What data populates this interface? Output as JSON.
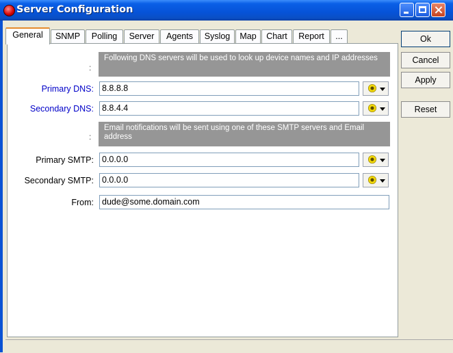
{
  "window": {
    "title": "Server Configuration"
  },
  "tabs": [
    "General",
    "SNMP",
    "Polling",
    "Server",
    "Agents",
    "Syslog",
    "Map",
    "Chart",
    "Report",
    "..."
  ],
  "active_tab": "General",
  "dns": {
    "info": "Following DNS servers will be used to look up device names and IP addresses",
    "colon": ":",
    "primary_label": "Primary DNS:",
    "primary_value": "8.8.8.8",
    "secondary_label": "Secondary DNS:",
    "secondary_value": "8.8.4.4"
  },
  "smtp": {
    "info": "Email notifications will be sent using one of these SMTP servers and Email address",
    "colon": ":",
    "primary_label": "Primary SMTP:",
    "primary_value": "0.0.0.0",
    "secondary_label": "Secondary SMTP:",
    "secondary_value": "0.0.0.0",
    "from_label": "From:",
    "from_value": "dude@some.domain.com"
  },
  "buttons": {
    "ok": "Ok",
    "cancel": "Cancel",
    "apply": "Apply",
    "reset": "Reset"
  },
  "colors": {
    "label_blue": "#0000c8",
    "titlebar": "#0653d8",
    "info_bg": "#969696"
  },
  "icons": {
    "picker": "gear-dropdown-icon"
  }
}
